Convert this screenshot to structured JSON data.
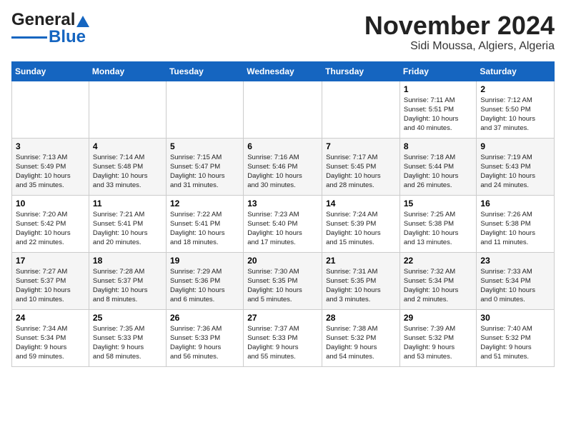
{
  "header": {
    "logo_line1": "General",
    "logo_line2": "Blue",
    "month": "November 2024",
    "location": "Sidi Moussa, Algiers, Algeria"
  },
  "weekdays": [
    "Sunday",
    "Monday",
    "Tuesday",
    "Wednesday",
    "Thursday",
    "Friday",
    "Saturday"
  ],
  "weeks": [
    [
      {
        "day": "",
        "info": ""
      },
      {
        "day": "",
        "info": ""
      },
      {
        "day": "",
        "info": ""
      },
      {
        "day": "",
        "info": ""
      },
      {
        "day": "",
        "info": ""
      },
      {
        "day": "1",
        "info": "Sunrise: 7:11 AM\nSunset: 5:51 PM\nDaylight: 10 hours\nand 40 minutes."
      },
      {
        "day": "2",
        "info": "Sunrise: 7:12 AM\nSunset: 5:50 PM\nDaylight: 10 hours\nand 37 minutes."
      }
    ],
    [
      {
        "day": "3",
        "info": "Sunrise: 7:13 AM\nSunset: 5:49 PM\nDaylight: 10 hours\nand 35 minutes."
      },
      {
        "day": "4",
        "info": "Sunrise: 7:14 AM\nSunset: 5:48 PM\nDaylight: 10 hours\nand 33 minutes."
      },
      {
        "day": "5",
        "info": "Sunrise: 7:15 AM\nSunset: 5:47 PM\nDaylight: 10 hours\nand 31 minutes."
      },
      {
        "day": "6",
        "info": "Sunrise: 7:16 AM\nSunset: 5:46 PM\nDaylight: 10 hours\nand 30 minutes."
      },
      {
        "day": "7",
        "info": "Sunrise: 7:17 AM\nSunset: 5:45 PM\nDaylight: 10 hours\nand 28 minutes."
      },
      {
        "day": "8",
        "info": "Sunrise: 7:18 AM\nSunset: 5:44 PM\nDaylight: 10 hours\nand 26 minutes."
      },
      {
        "day": "9",
        "info": "Sunrise: 7:19 AM\nSunset: 5:43 PM\nDaylight: 10 hours\nand 24 minutes."
      }
    ],
    [
      {
        "day": "10",
        "info": "Sunrise: 7:20 AM\nSunset: 5:42 PM\nDaylight: 10 hours\nand 22 minutes."
      },
      {
        "day": "11",
        "info": "Sunrise: 7:21 AM\nSunset: 5:41 PM\nDaylight: 10 hours\nand 20 minutes."
      },
      {
        "day": "12",
        "info": "Sunrise: 7:22 AM\nSunset: 5:41 PM\nDaylight: 10 hours\nand 18 minutes."
      },
      {
        "day": "13",
        "info": "Sunrise: 7:23 AM\nSunset: 5:40 PM\nDaylight: 10 hours\nand 17 minutes."
      },
      {
        "day": "14",
        "info": "Sunrise: 7:24 AM\nSunset: 5:39 PM\nDaylight: 10 hours\nand 15 minutes."
      },
      {
        "day": "15",
        "info": "Sunrise: 7:25 AM\nSunset: 5:38 PM\nDaylight: 10 hours\nand 13 minutes."
      },
      {
        "day": "16",
        "info": "Sunrise: 7:26 AM\nSunset: 5:38 PM\nDaylight: 10 hours\nand 11 minutes."
      }
    ],
    [
      {
        "day": "17",
        "info": "Sunrise: 7:27 AM\nSunset: 5:37 PM\nDaylight: 10 hours\nand 10 minutes."
      },
      {
        "day": "18",
        "info": "Sunrise: 7:28 AM\nSunset: 5:37 PM\nDaylight: 10 hours\nand 8 minutes."
      },
      {
        "day": "19",
        "info": "Sunrise: 7:29 AM\nSunset: 5:36 PM\nDaylight: 10 hours\nand 6 minutes."
      },
      {
        "day": "20",
        "info": "Sunrise: 7:30 AM\nSunset: 5:35 PM\nDaylight: 10 hours\nand 5 minutes."
      },
      {
        "day": "21",
        "info": "Sunrise: 7:31 AM\nSunset: 5:35 PM\nDaylight: 10 hours\nand 3 minutes."
      },
      {
        "day": "22",
        "info": "Sunrise: 7:32 AM\nSunset: 5:34 PM\nDaylight: 10 hours\nand 2 minutes."
      },
      {
        "day": "23",
        "info": "Sunrise: 7:33 AM\nSunset: 5:34 PM\nDaylight: 10 hours\nand 0 minutes."
      }
    ],
    [
      {
        "day": "24",
        "info": "Sunrise: 7:34 AM\nSunset: 5:34 PM\nDaylight: 9 hours\nand 59 minutes."
      },
      {
        "day": "25",
        "info": "Sunrise: 7:35 AM\nSunset: 5:33 PM\nDaylight: 9 hours\nand 58 minutes."
      },
      {
        "day": "26",
        "info": "Sunrise: 7:36 AM\nSunset: 5:33 PM\nDaylight: 9 hours\nand 56 minutes."
      },
      {
        "day": "27",
        "info": "Sunrise: 7:37 AM\nSunset: 5:33 PM\nDaylight: 9 hours\nand 55 minutes."
      },
      {
        "day": "28",
        "info": "Sunrise: 7:38 AM\nSunset: 5:32 PM\nDaylight: 9 hours\nand 54 minutes."
      },
      {
        "day": "29",
        "info": "Sunrise: 7:39 AM\nSunset: 5:32 PM\nDaylight: 9 hours\nand 53 minutes."
      },
      {
        "day": "30",
        "info": "Sunrise: 7:40 AM\nSunset: 5:32 PM\nDaylight: 9 hours\nand 51 minutes."
      }
    ]
  ]
}
